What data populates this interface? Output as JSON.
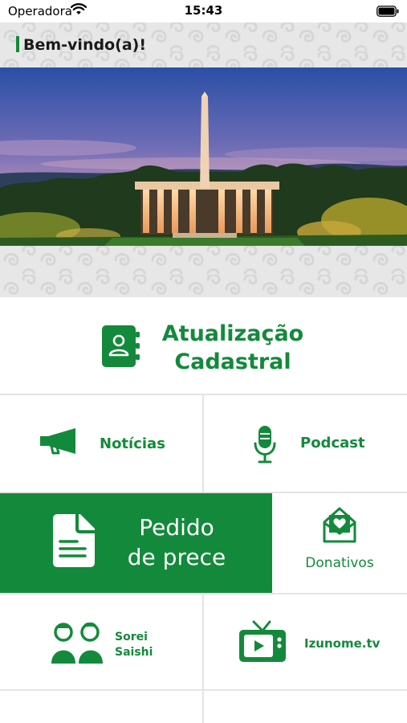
{
  "status_bar": {
    "carrier": "Operadora",
    "time": "15:43"
  },
  "header": {
    "title": "Bem-vindo(a)!"
  },
  "tiles": {
    "update": {
      "line1": "Atualização",
      "line2": "Cadastral"
    },
    "news": {
      "label": "Notícias"
    },
    "podcast": {
      "label": "Podcast"
    },
    "prayer": {
      "line1": "Pedido",
      "line2": "de prece"
    },
    "donations": {
      "label": "Donativos"
    },
    "sorei": {
      "line1": "Sorei",
      "line2": "Saishi"
    },
    "izunome": {
      "label": "Izunome.tv"
    }
  },
  "colors": {
    "brand_green": "#138a3b",
    "header_bg": "#e7e7e7"
  }
}
